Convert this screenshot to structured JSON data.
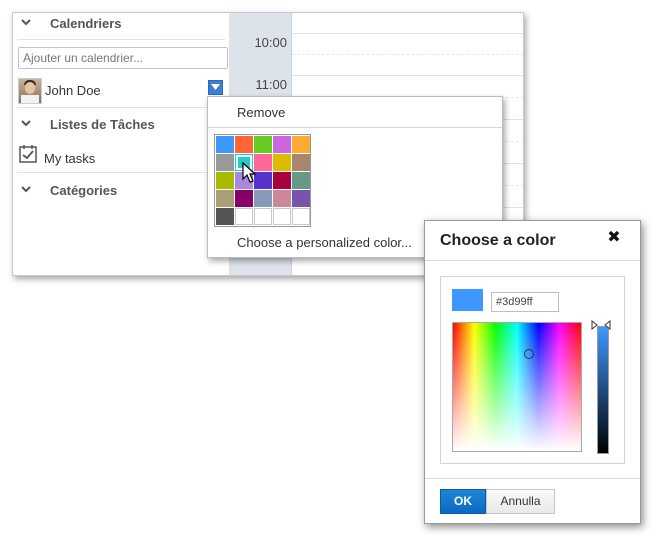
{
  "sidebar": {
    "calendars_title": "Calendriers",
    "add_calendar_placeholder": "Ajouter un calendrier...",
    "user_name": "John Doe",
    "tasks_title": "Listes de Tâches",
    "task_list_name": "My tasks",
    "categories_title": "Catégories"
  },
  "time_grid": {
    "times": [
      "10:00",
      "11:00"
    ]
  },
  "color_menu": {
    "remove_label": "Remove",
    "personalize_label": "Choose a personalized color...",
    "palette": [
      [
        "#3d99ff",
        "#ff6633",
        "#66cc22",
        "#cc66dd",
        "#ffaa33"
      ],
      [
        "#999999",
        "#22cccc",
        "#ff6699",
        "#ddbb00",
        "#a8866b"
      ],
      [
        "#a8bb00",
        "#aa88dd",
        "#5533cc",
        "#a8003c",
        "#669988"
      ],
      [
        "#aaa077",
        "#880066",
        "#8899bb",
        "#cc8899",
        "#7755aa"
      ],
      [
        "#555555",
        "",
        "",
        "",
        ""
      ]
    ],
    "selected_color": "#22cccc"
  },
  "color_dialog": {
    "title": "Choose a color",
    "hex_value": "#3d99ff",
    "preview_color": "#3d99ff",
    "ok_label": "OK",
    "cancel_label": "Annulla"
  }
}
